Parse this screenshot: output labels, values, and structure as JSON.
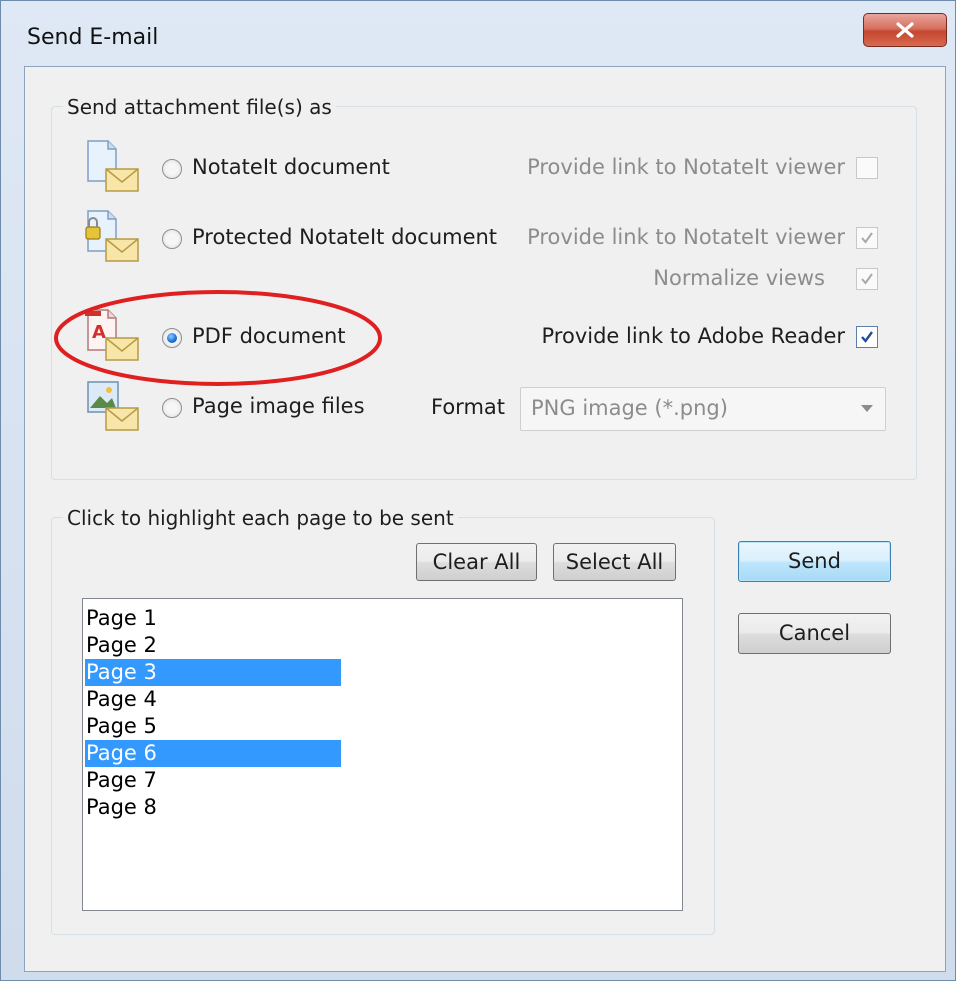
{
  "window": {
    "title": "Send E-mail"
  },
  "attach_group": {
    "legend": "Send attachment file(s) as",
    "options": [
      {
        "label": "NotateIt document",
        "icon": "document-email-icon",
        "checked": false
      },
      {
        "label": "Protected NotateIt document",
        "icon": "protected-document-email-icon",
        "checked": false
      },
      {
        "label": "PDF document",
        "icon": "pdf-email-icon",
        "checked": true
      },
      {
        "label": "Page image files",
        "icon": "image-email-icon",
        "checked": false
      }
    ],
    "checkboxes": [
      {
        "label": "Provide link to NotateIt viewer",
        "checked": false,
        "enabled": false
      },
      {
        "label": "Provide link to NotateIt viewer",
        "checked": true,
        "enabled": false
      },
      {
        "label": "Normalize views",
        "checked": true,
        "enabled": false
      },
      {
        "label": "Provide link to Adobe Reader",
        "checked": true,
        "enabled": true
      }
    ],
    "format_label": "Format",
    "format_value": "PNG image (*.png)"
  },
  "pages_group": {
    "legend": "Click to highlight each page to be sent",
    "clear_all": "Clear All",
    "select_all": "Select All",
    "pages": [
      {
        "label": "Page 1",
        "selected": false
      },
      {
        "label": "Page 2",
        "selected": false
      },
      {
        "label": "Page 3",
        "selected": true
      },
      {
        "label": "Page 4",
        "selected": false
      },
      {
        "label": "Page 5",
        "selected": false
      },
      {
        "label": "Page 6",
        "selected": true
      },
      {
        "label": "Page 7",
        "selected": false
      },
      {
        "label": "Page 8",
        "selected": false
      }
    ]
  },
  "actions": {
    "send": "Send",
    "cancel": "Cancel"
  },
  "colors": {
    "highlight_ellipse": "#e02020",
    "selection": "#3399ff"
  }
}
